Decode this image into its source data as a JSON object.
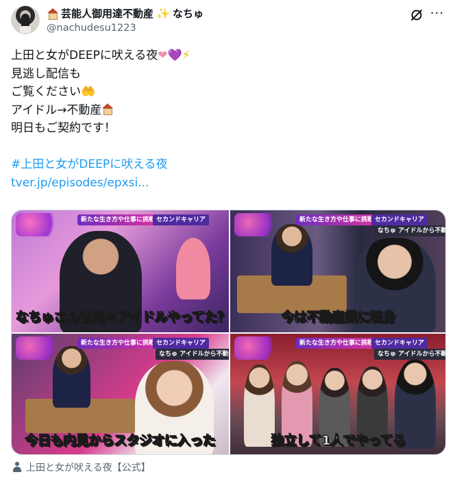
{
  "header": {
    "display_name": "芸能人御用達不動産",
    "display_name_suffix": "なちゅ",
    "sparkle": "✨",
    "handle": "@nachudesu1223",
    "grok_icon": "grok-icon",
    "more_icon": "more-icon",
    "more_glyph": "···"
  },
  "tweet": {
    "line1_text": "上田と女がDEEPに吠える夜",
    "line1_emojis": [
      "❤",
      "💜",
      "⚡"
    ],
    "line2": "見逃し配信も",
    "line3_text": "ご覧ください",
    "line3_emoji": "🤲",
    "line4_text": "アイドル→不動産",
    "line5": "明日もご契約です！",
    "hashtag": "#上田と女がDEEPに吠える夜",
    "link": "tver.jp/episodes/epxsi..."
  },
  "media": [
    {
      "banner_top": "新たな生き方や仕事に挑戦する",
      "banner_sub": "セカンドキャリア",
      "caption_white_before": "なちゅさんは",
      "caption_yellow": "元々",
      "caption_white_after": "アイドルやってた？"
    },
    {
      "banner_top": "新たな生き方や仕事に挑戦する",
      "banner_sub": "セカンドキャリア",
      "banner_name": "なちゅ アイドルから不動産業に",
      "caption_white_before": "今は",
      "caption_yellow": "不動産業",
      "caption_white_after": "に転身"
    },
    {
      "banner_top": "新たな生き方や仕事に挑戦する",
      "banner_sub": "セカンドキャリア",
      "banner_name": "なちゅ アイドルから不動産業に",
      "caption_white_before": "今日も",
      "caption_yellow": "内見",
      "caption_white_after": "からスタジオに入った"
    },
    {
      "banner_top": "新たな生き方や仕事に挑戦する",
      "banner_sub": "セカンドキャリア",
      "banner_name": "なちゅ アイドルから不動産業に",
      "caption_white_before": "",
      "caption_yellow": "",
      "caption_white_after": "独立して1人でやってる"
    }
  ],
  "footer": {
    "source_label": "上田と女が吠える夜【公式】"
  },
  "colors": {
    "link": "#1d9bf0",
    "secondary_text": "#536471",
    "primary_text": "#0f1419"
  }
}
